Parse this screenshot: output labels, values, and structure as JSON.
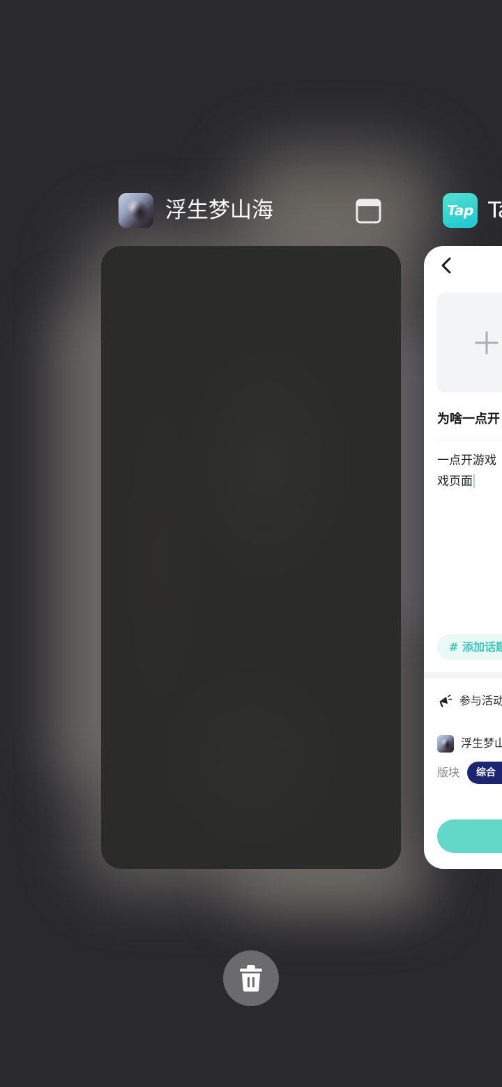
{
  "cards": [
    {
      "app_name": "浮生梦山海",
      "icon": "game-app-icon",
      "header_action_icon": "floating-window-icon"
    },
    {
      "app_name": "Ta",
      "icon": "taptap-app-icon",
      "icon_text": "Tap",
      "preview": {
        "back_icon": "back-chevron-icon",
        "add_image_icon": "plus-icon",
        "title": "为啥一点开",
        "body_lines": [
          "一点开游戏",
          "戏页面"
        ],
        "topic_button": "# 添加话题",
        "activity_icon": "megaphone-icon",
        "activity_label": "参与活动",
        "game_icon": "game-thumbnail-icon",
        "game_name": "浮生梦山",
        "section_label": "版块",
        "section_tag": "综合"
      }
    }
  ],
  "clear_all_icon": "trash-icon",
  "colors": {
    "background": "#29292e",
    "card_dark": "#2b2b2a",
    "accent_teal": "#3ec7bb",
    "button_teal": "#63d8c8",
    "tag_navy": "#1c2670",
    "trash_button": "#6b6b6d"
  }
}
